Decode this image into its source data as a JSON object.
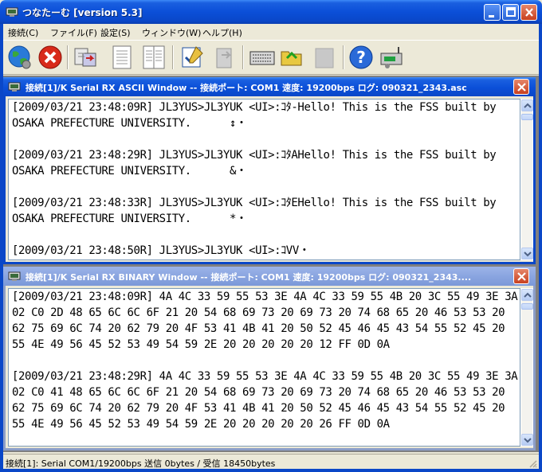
{
  "app": {
    "title": "つなたーむ [version 5.3]"
  },
  "menu": [
    {
      "label": "接続(C)"
    },
    {
      "label": "ファイル(F)"
    },
    {
      "label": "設定(S)"
    },
    {
      "label": "ウィンドウ(W)"
    },
    {
      "label": "ヘルプ(H)"
    }
  ],
  "toolbar": {
    "icons": [
      "connect-globe-icon",
      "disconnect-icon",
      "transfer-icon",
      "document-icon",
      "document-columns-icon",
      "edit-check-icon",
      "paste-icon",
      "keyboard-icon",
      "open-folder-icon",
      "disabled-icon",
      "help-icon",
      "tnc-device-icon"
    ]
  },
  "ascii_window": {
    "title": "接続[1]/K Serial RX ASCII Window -- 接続ポート: COM1 速度: 19200bps ログ: 090321_2343.asc",
    "lines": [
      "[2009/03/21 23:48:09R] JL3YUS>JL3YUK <UI>:ｺﾀ-Hello! This is the FSS built by",
      "OSAKA PREFECTURE UNIVERSITY.      ↕・",
      "",
      "[2009/03/21 23:48:29R] JL3YUS>JL3YUK <UI>:ｺﾀAHello! This is the FSS built by",
      "OSAKA PREFECTURE UNIVERSITY.      &・",
      "",
      "[2009/03/21 23:48:33R] JL3YUS>JL3YUK <UI>:ｺﾀEHello! This is the FSS built by",
      "OSAKA PREFECTURE UNIVERSITY.      *・",
      "",
      "[2009/03/21 23:48:50R] JL3YUS>JL3YUK <UI>:ｺVV・"
    ]
  },
  "binary_window": {
    "title": "接続[1]/K Serial RX BINARY Window -- 接続ポート: COM1 速度: 19200bps ログ: 090321_2343....",
    "lines": [
      "[2009/03/21 23:48:09R] 4A 4C 33 59 55 53 3E 4A 4C 33 59 55 4B 20 3C 55 49 3E 3A",
      "02 C0 2D 48 65 6C 6C 6F 21 20 54 68 69 73 20 69 73 20 74 68 65 20 46 53 53 20",
      "62 75 69 6C 74 20 62 79 20 4F 53 41 4B 41 20 50 52 45 46 45 43 54 55 52 45 20",
      "55 4E 49 56 45 52 53 49 54 59 2E 20 20 20 20 20 12 FF 0D 0A",
      "",
      "[2009/03/21 23:48:29R] 4A 4C 33 59 55 53 3E 4A 4C 33 59 55 4B 20 3C 55 49 3E 3A",
      "02 C0 41 48 65 6C 6C 6F 21 20 54 68 69 73 20 69 73 20 74 68 65 20 46 53 53 20",
      "62 75 69 6C 74 20 62 79 20 4F 53 41 4B 41 20 50 52 45 46 45 43 54 55 52 45 20",
      "55 4E 49 56 45 52 53 49 54 59 2E 20 20 20 20 20 26 FF 0D 0A"
    ]
  },
  "status": {
    "text": "接続[1]: Serial COM1/19200bps 送信 0bytes / 受信 18450bytes"
  },
  "colors": {
    "titlebar": "#0a47c8",
    "inactive_titlebar": "#8aa5e0",
    "face": "#ece9d8",
    "close_red": "#c8401f"
  }
}
